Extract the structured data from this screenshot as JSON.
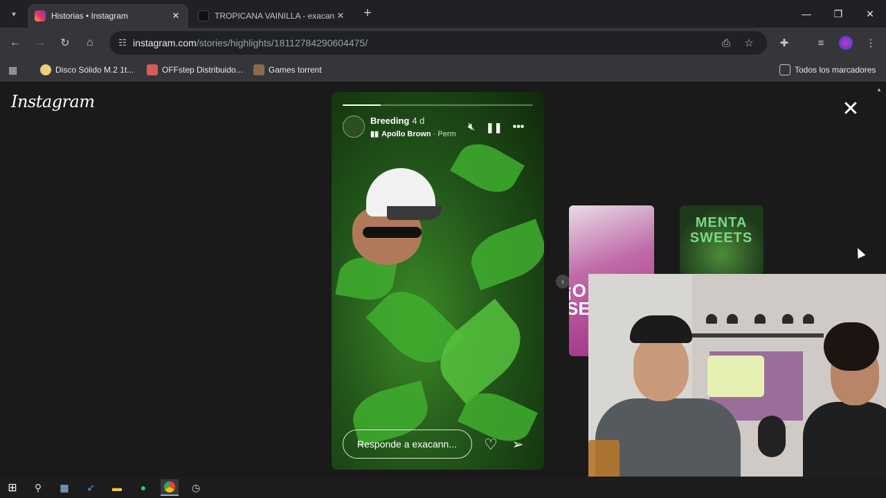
{
  "browser": {
    "tabs": [
      {
        "title": "Historias • Instagram",
        "active": true,
        "favicon": "instagram-icon"
      },
      {
        "title": "TROPICANA VAINILLA - exacannabis",
        "active": false,
        "favicon": "tiktok-icon"
      }
    ],
    "address": {
      "host": "instagram.com",
      "path": "/stories/highlights/18112784290604475/"
    },
    "bookmarks": [
      {
        "label": "Disco Sólido M.2 1t...",
        "icon": "disk-icon"
      },
      {
        "label": "OFFstep Distribuido...",
        "icon": "offstep-icon"
      },
      {
        "label": "Games torrent",
        "icon": "games-icon"
      }
    ],
    "all_bookmarks_label": "Todos los marcadores"
  },
  "instagram": {
    "logo": "Instagram",
    "story": {
      "username": "Breeding",
      "age": "4 d",
      "music_artist": "Apollo Brown",
      "music_song": "· Perm",
      "progress": 0.2,
      "reply_placeholder": "Responde a exacann..."
    },
    "next_story_text": "MENTA SWEETS"
  },
  "taskbar": {
    "apps": [
      "windows-start",
      "search",
      "calculator",
      "app-blue",
      "file-explorer",
      "spotify",
      "chrome",
      "app-clock"
    ]
  }
}
